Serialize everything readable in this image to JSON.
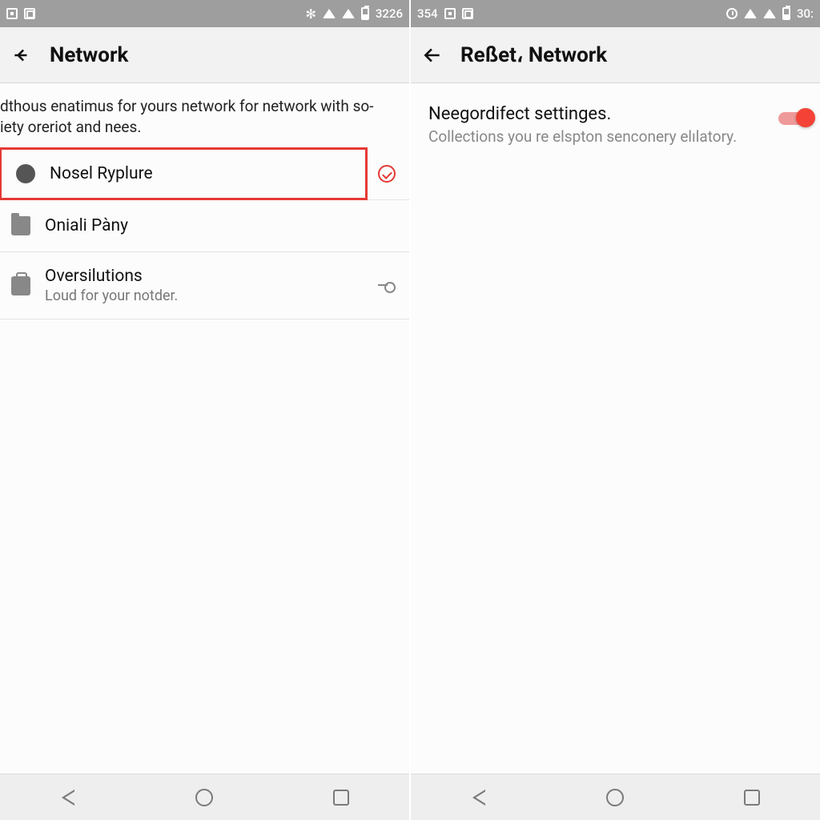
{
  "left": {
    "status": {
      "time": "3226"
    },
    "appbar": {
      "title": "Network"
    },
    "intro": "dthous enatimus for yours network for network with so-iety oreriot and nees.",
    "rows": [
      {
        "title": "Nosel Ryplure",
        "sub": ""
      },
      {
        "title": "Oniali Pàny",
        "sub": ""
      },
      {
        "title": "Oversilutions",
        "sub": "Loud for your notder."
      }
    ]
  },
  "right": {
    "status": {
      "left_time": "354",
      "time": "30:"
    },
    "appbar": {
      "title": "Reßet، Network"
    },
    "setting": {
      "title": "Neegordifect settinges.",
      "sub": "Collections you re elspton senconery elılatory."
    }
  }
}
